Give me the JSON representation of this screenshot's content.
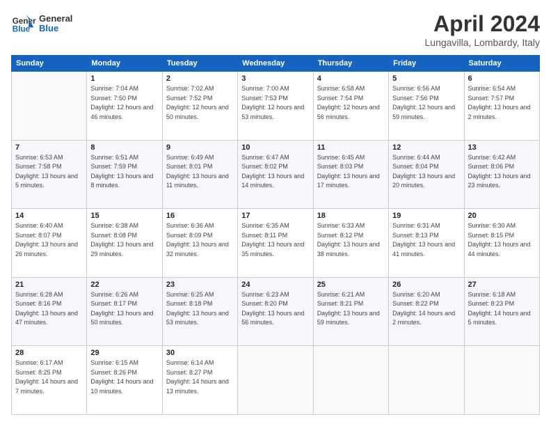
{
  "header": {
    "logo_general": "General",
    "logo_blue": "Blue",
    "month_title": "April 2024",
    "subtitle": "Lungavilla, Lombardy, Italy"
  },
  "columns": [
    "Sunday",
    "Monday",
    "Tuesday",
    "Wednesday",
    "Thursday",
    "Friday",
    "Saturday"
  ],
  "weeks": [
    [
      {
        "day": "",
        "sunrise": "",
        "sunset": "",
        "daylight": ""
      },
      {
        "day": "1",
        "sunrise": "Sunrise: 7:04 AM",
        "sunset": "Sunset: 7:50 PM",
        "daylight": "Daylight: 12 hours and 46 minutes."
      },
      {
        "day": "2",
        "sunrise": "Sunrise: 7:02 AM",
        "sunset": "Sunset: 7:52 PM",
        "daylight": "Daylight: 12 hours and 50 minutes."
      },
      {
        "day": "3",
        "sunrise": "Sunrise: 7:00 AM",
        "sunset": "Sunset: 7:53 PM",
        "daylight": "Daylight: 12 hours and 53 minutes."
      },
      {
        "day": "4",
        "sunrise": "Sunrise: 6:58 AM",
        "sunset": "Sunset: 7:54 PM",
        "daylight": "Daylight: 12 hours and 56 minutes."
      },
      {
        "day": "5",
        "sunrise": "Sunrise: 6:56 AM",
        "sunset": "Sunset: 7:56 PM",
        "daylight": "Daylight: 12 hours and 59 minutes."
      },
      {
        "day": "6",
        "sunrise": "Sunrise: 6:54 AM",
        "sunset": "Sunset: 7:57 PM",
        "daylight": "Daylight: 13 hours and 2 minutes."
      }
    ],
    [
      {
        "day": "7",
        "sunrise": "Sunrise: 6:53 AM",
        "sunset": "Sunset: 7:58 PM",
        "daylight": "Daylight: 13 hours and 5 minutes."
      },
      {
        "day": "8",
        "sunrise": "Sunrise: 6:51 AM",
        "sunset": "Sunset: 7:59 PM",
        "daylight": "Daylight: 13 hours and 8 minutes."
      },
      {
        "day": "9",
        "sunrise": "Sunrise: 6:49 AM",
        "sunset": "Sunset: 8:01 PM",
        "daylight": "Daylight: 13 hours and 11 minutes."
      },
      {
        "day": "10",
        "sunrise": "Sunrise: 6:47 AM",
        "sunset": "Sunset: 8:02 PM",
        "daylight": "Daylight: 13 hours and 14 minutes."
      },
      {
        "day": "11",
        "sunrise": "Sunrise: 6:45 AM",
        "sunset": "Sunset: 8:03 PM",
        "daylight": "Daylight: 13 hours and 17 minutes."
      },
      {
        "day": "12",
        "sunrise": "Sunrise: 6:44 AM",
        "sunset": "Sunset: 8:04 PM",
        "daylight": "Daylight: 13 hours and 20 minutes."
      },
      {
        "day": "13",
        "sunrise": "Sunrise: 6:42 AM",
        "sunset": "Sunset: 8:06 PM",
        "daylight": "Daylight: 13 hours and 23 minutes."
      }
    ],
    [
      {
        "day": "14",
        "sunrise": "Sunrise: 6:40 AM",
        "sunset": "Sunset: 8:07 PM",
        "daylight": "Daylight: 13 hours and 26 minutes."
      },
      {
        "day": "15",
        "sunrise": "Sunrise: 6:38 AM",
        "sunset": "Sunset: 8:08 PM",
        "daylight": "Daylight: 13 hours and 29 minutes."
      },
      {
        "day": "16",
        "sunrise": "Sunrise: 6:36 AM",
        "sunset": "Sunset: 8:09 PM",
        "daylight": "Daylight: 13 hours and 32 minutes."
      },
      {
        "day": "17",
        "sunrise": "Sunrise: 6:35 AM",
        "sunset": "Sunset: 8:11 PM",
        "daylight": "Daylight: 13 hours and 35 minutes."
      },
      {
        "day": "18",
        "sunrise": "Sunrise: 6:33 AM",
        "sunset": "Sunset: 8:12 PM",
        "daylight": "Daylight: 13 hours and 38 minutes."
      },
      {
        "day": "19",
        "sunrise": "Sunrise: 6:31 AM",
        "sunset": "Sunset: 8:13 PM",
        "daylight": "Daylight: 13 hours and 41 minutes."
      },
      {
        "day": "20",
        "sunrise": "Sunrise: 6:30 AM",
        "sunset": "Sunset: 8:15 PM",
        "daylight": "Daylight: 13 hours and 44 minutes."
      }
    ],
    [
      {
        "day": "21",
        "sunrise": "Sunrise: 6:28 AM",
        "sunset": "Sunset: 8:16 PM",
        "daylight": "Daylight: 13 hours and 47 minutes."
      },
      {
        "day": "22",
        "sunrise": "Sunrise: 6:26 AM",
        "sunset": "Sunset: 8:17 PM",
        "daylight": "Daylight: 13 hours and 50 minutes."
      },
      {
        "day": "23",
        "sunrise": "Sunrise: 6:25 AM",
        "sunset": "Sunset: 8:18 PM",
        "daylight": "Daylight: 13 hours and 53 minutes."
      },
      {
        "day": "24",
        "sunrise": "Sunrise: 6:23 AM",
        "sunset": "Sunset: 8:20 PM",
        "daylight": "Daylight: 13 hours and 56 minutes."
      },
      {
        "day": "25",
        "sunrise": "Sunrise: 6:21 AM",
        "sunset": "Sunset: 8:21 PM",
        "daylight": "Daylight: 13 hours and 59 minutes."
      },
      {
        "day": "26",
        "sunrise": "Sunrise: 6:20 AM",
        "sunset": "Sunset: 8:22 PM",
        "daylight": "Daylight: 14 hours and 2 minutes."
      },
      {
        "day": "27",
        "sunrise": "Sunrise: 6:18 AM",
        "sunset": "Sunset: 8:23 PM",
        "daylight": "Daylight: 14 hours and 5 minutes."
      }
    ],
    [
      {
        "day": "28",
        "sunrise": "Sunrise: 6:17 AM",
        "sunset": "Sunset: 8:25 PM",
        "daylight": "Daylight: 14 hours and 7 minutes."
      },
      {
        "day": "29",
        "sunrise": "Sunrise: 6:15 AM",
        "sunset": "Sunset: 8:26 PM",
        "daylight": "Daylight: 14 hours and 10 minutes."
      },
      {
        "day": "30",
        "sunrise": "Sunrise: 6:14 AM",
        "sunset": "Sunset: 8:27 PM",
        "daylight": "Daylight: 14 hours and 13 minutes."
      },
      {
        "day": "",
        "sunrise": "",
        "sunset": "",
        "daylight": ""
      },
      {
        "day": "",
        "sunrise": "",
        "sunset": "",
        "daylight": ""
      },
      {
        "day": "",
        "sunrise": "",
        "sunset": "",
        "daylight": ""
      },
      {
        "day": "",
        "sunrise": "",
        "sunset": "",
        "daylight": ""
      }
    ]
  ]
}
